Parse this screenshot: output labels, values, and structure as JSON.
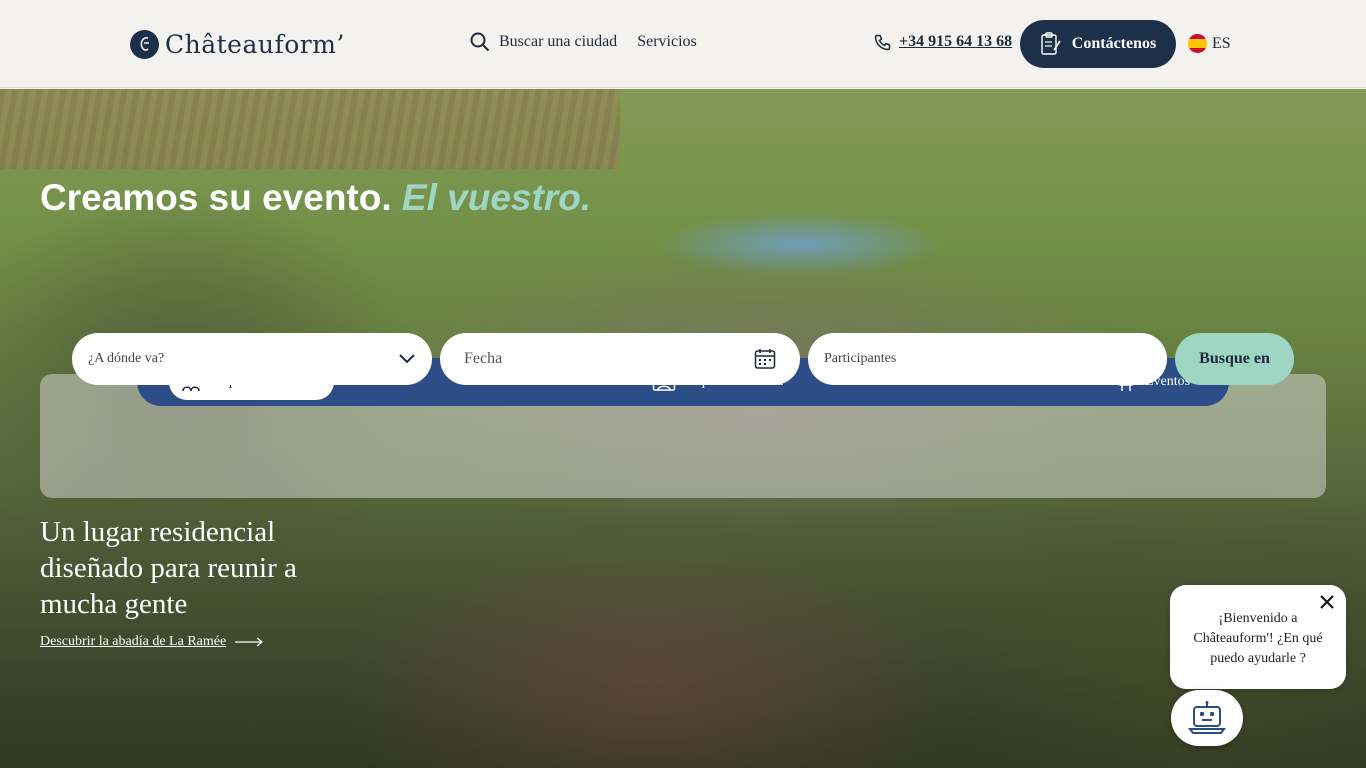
{
  "header": {
    "logo_text": "Châteauform’",
    "nav": [
      {
        "label": "Buscar una ciudad",
        "icon": "search-icon"
      },
      {
        "label": "Servicios"
      }
    ],
    "phone": "+34 915 64 13 68",
    "contact_label": "Contáctenos",
    "lang": "ES"
  },
  "hero": {
    "title_main": "Creamos su evento.",
    "title_accent": "El vuestro.",
    "accent_color": "#9fd5c3"
  },
  "search": {
    "tabs": [
      {
        "label": "Paquete Residencial",
        "icon": "people-house-icon",
        "active": true
      },
      {
        "label": "Paquete de un día",
        "icon": "presenter-icon",
        "active": false
      },
      {
        "label": "Eventos",
        "icon": "party-icon",
        "active": false
      }
    ],
    "destination_placeholder": "¿A dónde va?",
    "date_placeholder": "Fecha",
    "participants_placeholder": "Participantes",
    "submit_label": "Busque en"
  },
  "slide": {
    "title": "Un lugar residencial diseñado para reunir a mucha gente",
    "link": "Descubrir la abadía de La Ramée"
  },
  "chat": {
    "message": "¡Bienvenido a Châteauform'! ¿En qué puedo ayudarle ?"
  },
  "colors": {
    "brand_dark": "#1d3049",
    "tab_bar": "#2c4d85",
    "search_button": "#9fd5c3"
  }
}
